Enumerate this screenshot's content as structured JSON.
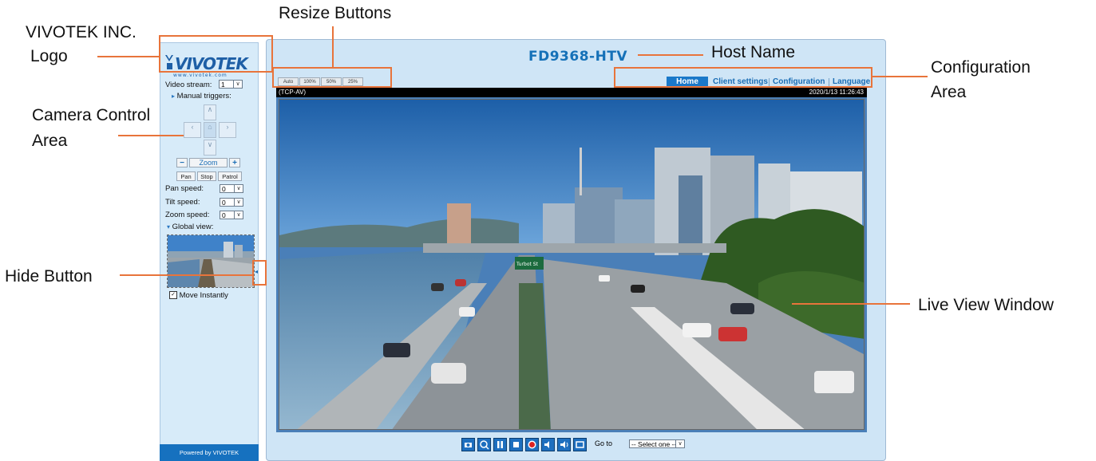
{
  "callouts": {
    "logo_line1": "VIVOTEK INC.",
    "logo_line2": "Logo",
    "resize": "Resize Buttons",
    "host": "Host Name",
    "config_line1": "Configuration",
    "config_line2": "Area",
    "camera_line1": "Camera Control",
    "camera_line2": "Area",
    "hide": "Hide Button",
    "live": "Live View Window"
  },
  "logo": {
    "text": "VIVOTEK",
    "sub": "www.vivotek.com"
  },
  "host_name": "FD9368-HTV",
  "resize_buttons": [
    "Auto",
    "100%",
    "50%",
    "25%"
  ],
  "nav": [
    {
      "label": "Home",
      "active": true
    },
    {
      "label": "Client settings",
      "active": false
    },
    {
      "label": "Configuration",
      "active": false
    },
    {
      "label": "Language",
      "active": false
    }
  ],
  "sidebar": {
    "video_stream_label": "Video stream:",
    "video_stream_value": "1",
    "manual_triggers": "Manual triggers:",
    "zoom_label": "Zoom",
    "zoom_minus": "−",
    "zoom_plus": "+",
    "pan_btn": "Pan",
    "stop_btn": "Stop",
    "patrol_btn": "Patrol",
    "pan_speed_label": "Pan speed:",
    "pan_speed_value": "0",
    "tilt_speed_label": "Tilt speed:",
    "tilt_speed_value": "0",
    "zoom_speed_label": "Zoom speed:",
    "zoom_speed_value": "0",
    "global_view": "Global view:",
    "move_instantly": "Move Instantly",
    "move_instantly_checked": true,
    "footer": "Powered by VIVOTEK"
  },
  "video": {
    "stream_mode": "(TCP-AV)",
    "timestamp": "2020/1/13 11:26:43",
    "sign_text": "Turbot St"
  },
  "controls": {
    "icons": [
      "snapshot-icon",
      "digital-zoom-icon",
      "pause-icon",
      "stop-icon",
      "record-icon",
      "volume-icon",
      "mute-icon",
      "fullscreen-icon"
    ],
    "goto_label": "Go to",
    "goto_value": "-- Select one --"
  },
  "colors": {
    "accent": "#e8743b",
    "brand_blue": "#1571b8",
    "nav_active": "#1a78c9",
    "panel_bg": "#cfe5f6"
  }
}
